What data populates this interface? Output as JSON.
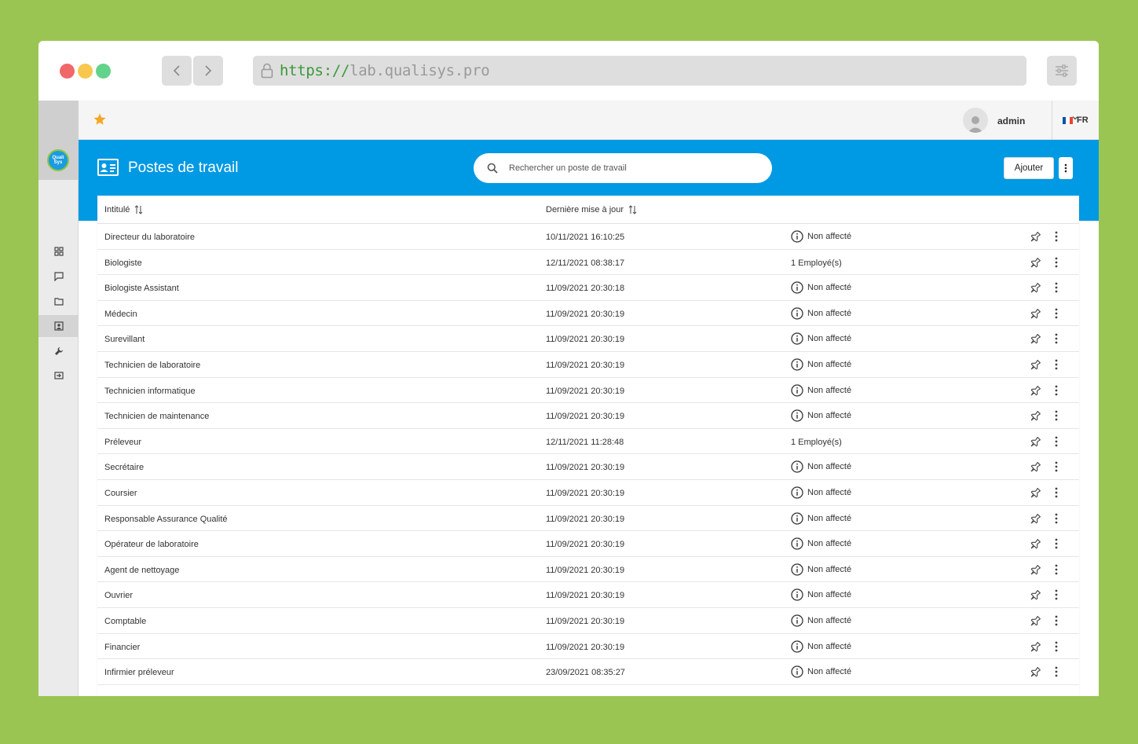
{
  "browser": {
    "url_protocol": "https://",
    "url_host": "lab.qualisys.pro"
  },
  "sidebar": {
    "logo_text": "Quali Sys",
    "items": [
      {
        "icon": "dashboard-icon"
      },
      {
        "icon": "chat-icon"
      },
      {
        "icon": "folder-icon"
      },
      {
        "icon": "id-card-icon",
        "active": true
      },
      {
        "icon": "wrench-icon"
      },
      {
        "icon": "logout-icon"
      }
    ]
  },
  "header": {
    "user_name": "admin",
    "language": "FR"
  },
  "page": {
    "title": "Postes de travail",
    "search_placeholder": "Rechercher un poste de travail",
    "add_label": "Ajouter"
  },
  "table": {
    "columns": [
      "Intitulé",
      "Dernière mise à jour"
    ],
    "rows": [
      {
        "title": "Directeur du laboratoire",
        "updated": "10/11/2021 16:10:25",
        "status": "Non affecté",
        "unassigned": true
      },
      {
        "title": "Biologiste",
        "updated": "12/11/2021 08:38:17",
        "status": "1 Employé(s)",
        "unassigned": false
      },
      {
        "title": "Biologiste Assistant",
        "updated": "11/09/2021 20:30:18",
        "status": "Non affecté",
        "unassigned": true
      },
      {
        "title": "Médecin",
        "updated": "11/09/2021 20:30:19",
        "status": "Non affecté",
        "unassigned": true
      },
      {
        "title": "Surevillant",
        "updated": "11/09/2021 20:30:19",
        "status": "Non affecté",
        "unassigned": true
      },
      {
        "title": "Technicien de laboratoire",
        "updated": "11/09/2021 20:30:19",
        "status": "Non affecté",
        "unassigned": true
      },
      {
        "title": "Technicien informatique",
        "updated": "11/09/2021 20:30:19",
        "status": "Non affecté",
        "unassigned": true
      },
      {
        "title": "Technicien de maintenance",
        "updated": "11/09/2021 20:30:19",
        "status": "Non affecté",
        "unassigned": true
      },
      {
        "title": "Préleveur",
        "updated": "12/11/2021 11:28:48",
        "status": "1 Employé(s)",
        "unassigned": false
      },
      {
        "title": "Secrétaire",
        "updated": "11/09/2021 20:30:19",
        "status": "Non affecté",
        "unassigned": true
      },
      {
        "title": "Coursier",
        "updated": "11/09/2021 20:30:19",
        "status": "Non affecté",
        "unassigned": true
      },
      {
        "title": "Responsable Assurance Qualité",
        "updated": "11/09/2021 20:30:19",
        "status": "Non affecté",
        "unassigned": true
      },
      {
        "title": "Opérateur de laboratoire",
        "updated": "11/09/2021 20:30:19",
        "status": "Non affecté",
        "unassigned": true
      },
      {
        "title": "Agent de nettoyage",
        "updated": "11/09/2021 20:30:19",
        "status": "Non affecté",
        "unassigned": true
      },
      {
        "title": "Ouvrier",
        "updated": "11/09/2021 20:30:19",
        "status": "Non affecté",
        "unassigned": true
      },
      {
        "title": "Comptable",
        "updated": "11/09/2021 20:30:19",
        "status": "Non affecté",
        "unassigned": true
      },
      {
        "title": "Financier",
        "updated": "11/09/2021 20:30:19",
        "status": "Non affecté",
        "unassigned": true
      },
      {
        "title": "Infirmier préleveur",
        "updated": "23/09/2021 08:35:27",
        "status": "Non affecté",
        "unassigned": true
      }
    ]
  },
  "colors": {
    "accent": "#0099e3",
    "page_background": "#9bc553",
    "favorite_star": "#f5a623"
  }
}
